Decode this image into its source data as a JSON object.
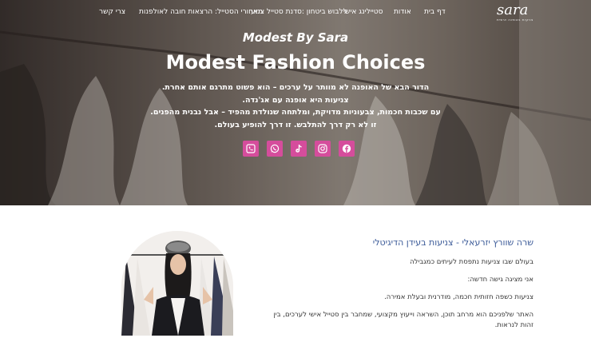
{
  "nav": {
    "logo_text": "sara",
    "logo_tagline": "צניעות באופנה אישית",
    "items": [
      {
        "label": "דף בית"
      },
      {
        "label": "אודות"
      },
      {
        "label": "סטיילינג אישי"
      },
      {
        "label": "ללבוש ביטחון :סדנת סטייל צנוע"
      },
      {
        "label": "מאחורי הסטייל: הרצאות חובה לאולפנות"
      },
      {
        "label": "צרי קשר"
      }
    ]
  },
  "hero": {
    "subtitle": "Modest By Sara",
    "title": "Modest Fashion Choices",
    "lines": [
      "הדור הבא של האופנה לא מוותר על ערכים – הוא פשוט מתרגם אותם אחרת.",
      "צניעות היא אופנה עם אג'נדה.",
      "עם שכבות חכמות, צבעוניות מדויקת, ומלתחה שנולדת מהפיד – אבל נבנית מהפנים.",
      "זו לא רק דרך להתלבש. זו דרך להופיע בעולם."
    ],
    "socials": [
      {
        "icon": "phone-icon"
      },
      {
        "icon": "whatsapp-icon"
      },
      {
        "icon": "tiktok-icon"
      },
      {
        "icon": "instagram-icon"
      },
      {
        "icon": "facebook-icon"
      }
    ],
    "social_color": "#d54d9c"
  },
  "about": {
    "heading": "שרה שוורץ יזרעאלי - צניעות בעידן הדיגיטלי",
    "paragraphs": [
      "בעולם שבו צניעות נתפסת לעיתים כמגבילה",
      "אני מציגה גישה חדשה:",
      "צניעות כשפה חזותית חכמה, מודרנית ובעלת אמירה.",
      "האתר שלפניכם הוא מרחב תוכן, השראה וייעוץ מקצועי, שמחבר בין סטייל אישי לערכים, בין זהות לנראות."
    ],
    "heading_color": "#3b5a98"
  }
}
